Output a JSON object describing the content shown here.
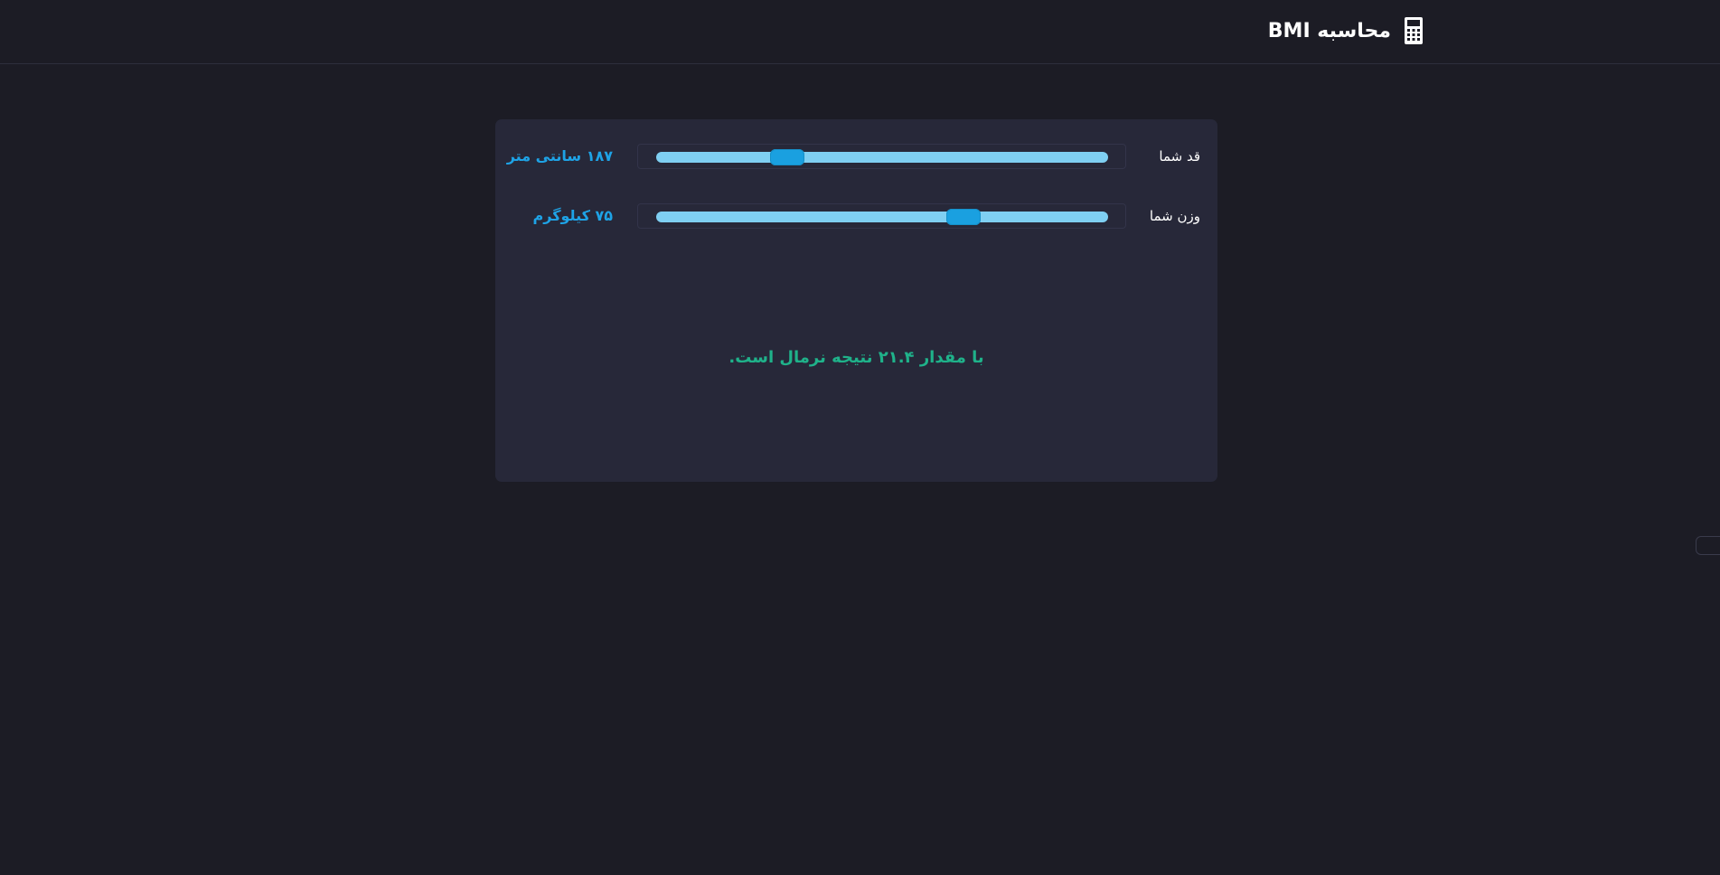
{
  "header": {
    "title": "محاسبه BMI",
    "icon": "calculator-icon"
  },
  "calculator": {
    "height": {
      "label": "قد شما",
      "value_text": "۱۸۷ سانتی متر",
      "slider_fraction": 0.29
    },
    "weight": {
      "label": "وزن شما",
      "value_text": "۷۵ کیلوگرم",
      "slider_fraction": 0.68
    },
    "result_text": "با مقدار ۲۱.۴ نتیجه نرمال است."
  },
  "colors": {
    "background": "#1c1c25",
    "card": "#272839",
    "track": "#7fcff2",
    "thumb": "#1aa0e0",
    "value": "#1ea3e6",
    "result": "#1fb28a"
  }
}
